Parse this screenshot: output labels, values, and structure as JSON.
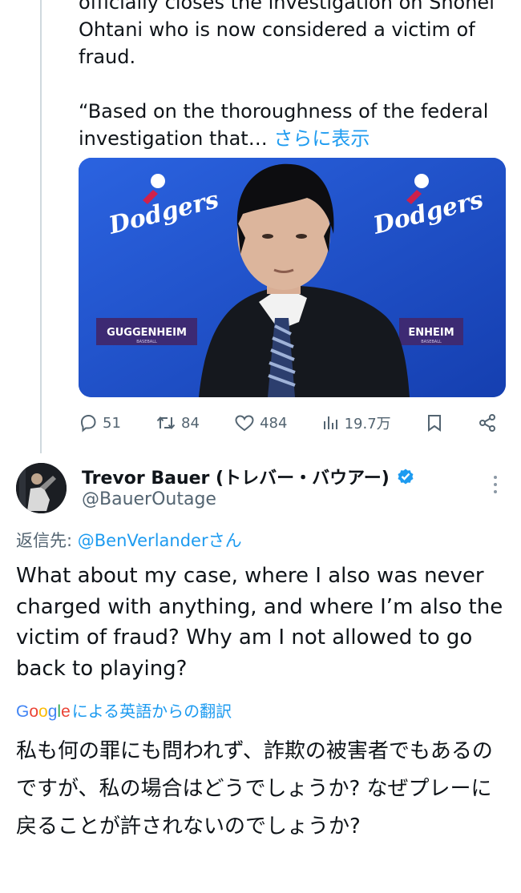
{
  "quoted_tweet": {
    "text_lines": [
      "officially closes the investigation on Shohei",
      "Ohtani who is now considered a victim of",
      "fraud."
    ],
    "text_line2_prefix": "“Based on the thoroughness of the federal",
    "text_line3_prefix": "investigation that…",
    "show_more": "さらに表示",
    "media": {
      "left_logo": "Dodgers",
      "right_logo": "Dodgers",
      "left_sign": "GUGGENHEIM",
      "right_sign": "ENHEIM",
      "sign_sub": "BASEBALL",
      "background_color": "#1d4fc9"
    },
    "actions": {
      "replies": "51",
      "reposts": "84",
      "likes": "484",
      "views": "19.7万"
    }
  },
  "reply_tweet": {
    "display_name": "Trevor Bauer (トレバー・バウアー)",
    "handle": "@BauerOutage",
    "replying_prefix": "返信先: ",
    "replying_to": "@BenVerlanderさん",
    "body": "What about my case, where I also was never charged with anything, and where I’m also the victim of fraud? Why am I not allowed to go back to playing?",
    "translate": {
      "google_letters": [
        "G",
        "o",
        "o",
        "g",
        "l",
        "e"
      ],
      "label": "による英語からの翻訳"
    },
    "translated_body": "私も何の罪にも問われず、詐欺の被害者でもあるのですが、私の場合はどうでしょうか? なぜプレーに戻ることが許されないのでしょうか?"
  },
  "colors": {
    "link": "#1d9bf0",
    "secondary": "#536471",
    "verified": "#1d9bf0",
    "google": [
      "#4285F4",
      "#EA4335",
      "#FBBC05",
      "#4285F4",
      "#34A853",
      "#EA4335"
    ]
  }
}
